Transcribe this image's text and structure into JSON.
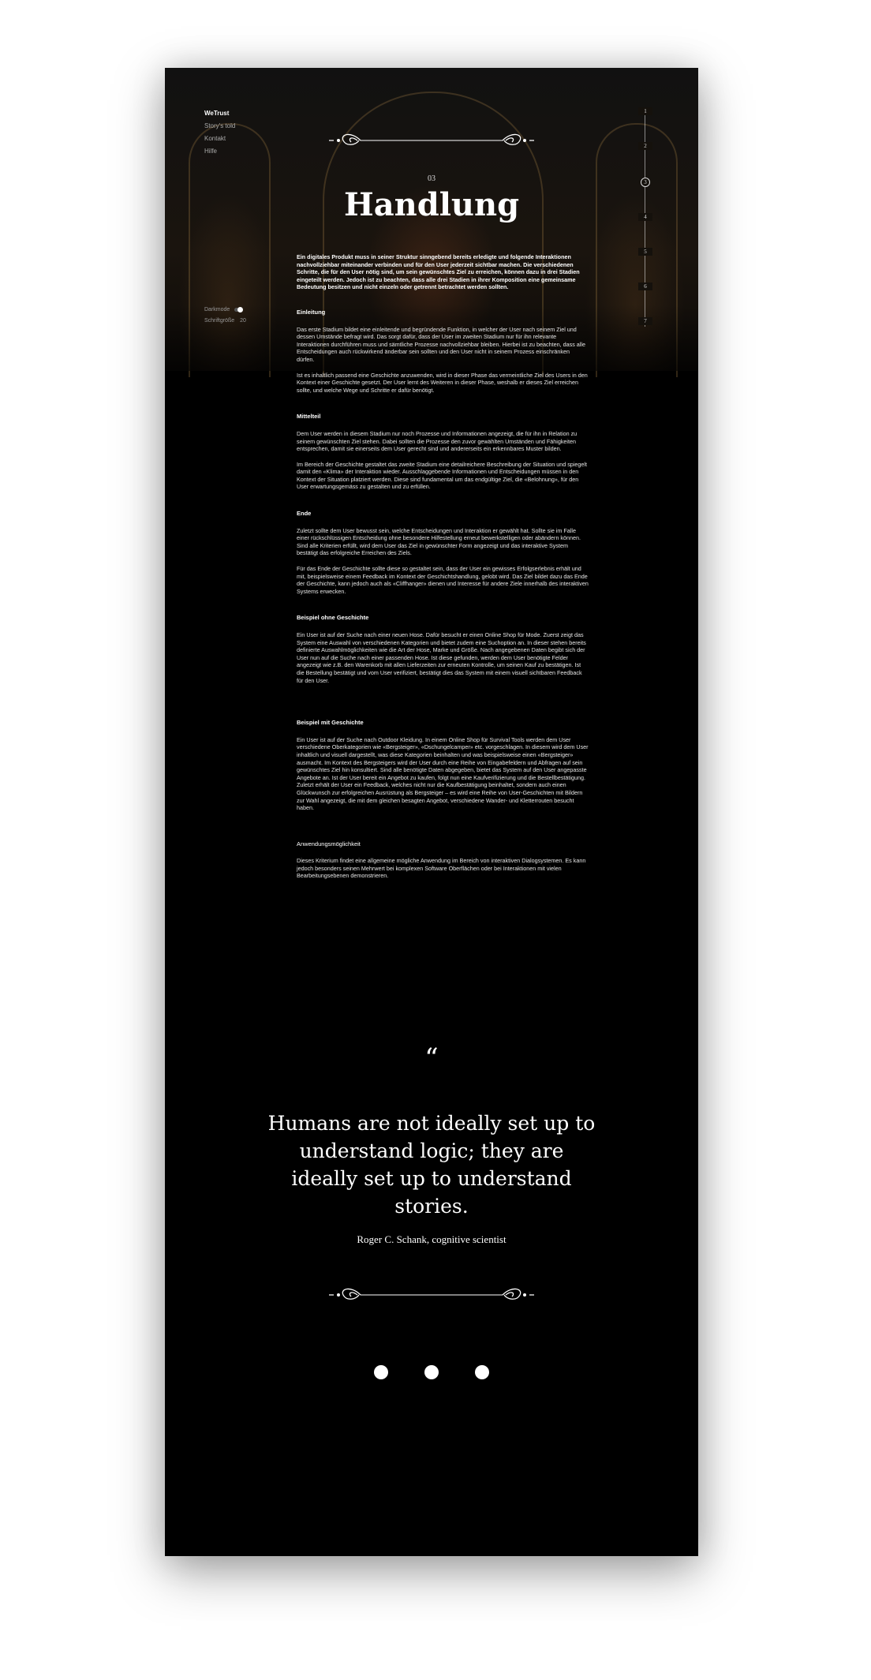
{
  "nav": {
    "brand": "WeTrust",
    "items": [
      "Story's told",
      "Kontakt",
      "Hilfe"
    ]
  },
  "settings": {
    "darkmode_label": "Darkmode",
    "font_size_label": "Schriftgröße",
    "font_size_value": "20",
    "darkmode_on": true
  },
  "steps": [
    "1",
    "2",
    "3",
    "4",
    "5",
    "6",
    "7"
  ],
  "active_step": "3",
  "section": {
    "number": "03",
    "title": "Handlung",
    "lead": "Ein digitales Produkt muss in seiner Struktur sinngebend bereits erledigte und folgende Interaktionen nachvollziehbar miteinander verbinden und für den User jederzeit sichtbar machen. Die verschiedenen Schritte, die für den User nötig sind, um sein gewünschtes Ziel zu erreichen, können dazu in drei Stadien eingeteilt werden. Jedoch ist zu beachten, dass alle drei Stadien in ihrer Komposition eine gemeinsame Bedeutung besitzen und nicht einzeln oder getrennt betrachtet werden sollten."
  },
  "blocks": [
    {
      "heading": "Einleitung",
      "paragraphs": [
        "Das erste Stadium bildet eine einleitende und begründende Funktion, in welcher der User nach seinem Ziel und dessen Umstände befragt wird. Das sorgt dafür, dass der User im zweiten Stadium nur für ihn relevante Interaktionen durchführen muss und sämtliche Prozesse nachvollziehbar bleiben. Hierbei ist zu beachten, dass alle Entscheidungen auch rückwirkend änderbar sein sollten und den User nicht in seinem Prozess einschränken dürfen.",
        "Ist es inhaltlich passend eine Geschichte anzuwenden, wird in dieser Phase das vermeintliche Ziel des Users in den Kontext einer Geschichte gesetzt. Der User lernt des Weiteren in dieser Phase, weshalb er dieses Ziel erreichen sollte, und welche Wege und Schritte er dafür benötigt."
      ]
    },
    {
      "heading": "Mittelteil",
      "paragraphs": [
        "Dem User werden in diesem Stadium nur noch Prozesse und Informationen angezeigt, die für ihn in Relation zu seinem gewünschten Ziel stehen. Dabei sollten die Prozesse den zuvor gewählten Umständen und Fähigkeiten entsprechen, damit sie einerseits dem User gerecht sind und andererseits ein erkennbares Muster bilden.",
        "Im Bereich der Geschichte gestaltet das zweite Stadium eine detailreichere Beschreibung der Situation und spiegelt damit den «Klima» der Interaktion wieder. Ausschlaggebende Informationen und Entscheidungen müssen in den Kontext der Situation platziert werden. Diese sind fundamental um das endgültige Ziel, die «Belohnung», für den User erwartungsgemäss zu gestalten und zu erfüllen."
      ]
    },
    {
      "heading": "Ende",
      "paragraphs": [
        "Zuletzt sollte dem User bewusst sein, welche Entscheidungen und Interaktion er gewählt hat. Sollte sie im Falle einer rückschlüssigen Entscheidung ohne besondere Hilfestellung erneut bewerkstelligen oder abändern können. Sind alle Kriterien erfüllt, wird dem User das Ziel in gewünschter Form angezeigt und das interaktive System bestätigt das erfolgreiche Erreichen des Ziels.",
        "Für das Ende der Geschichte sollte diese so gestaltet sein, dass der User ein gewisses Erfolgserlebnis erhält und mit, beispielsweise einem Feedback im Kontext der Geschichtshandlung, gelobt wird. Das Ziel bildet dazu das Ende der Geschichte, kann jedoch auch als «Cliffhanger» dienen und Interesse für andere Ziele innerhalb des interaktiven Systems erwecken."
      ]
    },
    {
      "heading": "Beispiel ohne Geschichte",
      "paragraphs": [
        "Ein User ist auf der Suche nach einer neuen Hose. Dafür besucht er einen Online Shop für Mode. Zuerst zeigt das System eine Auswahl von verschiedenen Kategorien und bietet zudem eine Suchoption an. In dieser stehen bereits definierte Auswahlmöglichkeiten wie die Art der Hose, Marke und Größe. Nach angegebenen Daten begibt sich der User nun auf die Suche nach einer passenden Hose. Ist diese gefunden, werden dem User benötigte Felder angezeigt wie z.B. den Warenkorb mit allen Lieferzeiten zur erneuten Kontrolle, um seinen Kauf zu bestätigen. Ist die Bestellung bestätigt und vom User verifiziert, bestätigt dies das System mit einem visuell sichtbaren Feedback für den User."
      ]
    },
    {
      "heading": "Beispiel mit Geschichte",
      "paragraphs": [
        "Ein User ist auf der Suche nach Outdoor Kleidung. In einem Online Shop für Survival Tools werden dem User verschiedene Oberkategorien wie «Bergsteiger», «Dschungelcamper» etc. vorgeschlagen. In diesem wird dem User inhaltlich und visuell dargestellt, was diese Kategorien beinhalten und was beispielsweise einen «Bergsteiger» ausmacht. Im Kontext des Bergsteigers wird der User durch eine Reihe von Eingabefeldern und Abfragen auf sein gewünschtes Ziel hin konsultiert. Sind alle benötigte Daten abgegeben, bietet das System auf den User angepasste Angebote an. Ist der User bereit ein Angebot zu kaufen, folgt nun eine Kaufverifizierung und die Bestellbestätigung. Zuletzt erhält der User ein Feedback, welches nicht nur die Kaufbestätigung beinhaltet, sondern auch einen Glückwunsch zur erfolgreichen Ausrüstung als Bergsteiger – es wird eine Reihe von User-Geschichten mit Bildern zur Wahl angezeigt, die mit dem gleichen besagten Angebot, verschiedene Wander- und Kletterrouten besucht haben."
      ]
    },
    {
      "heading": "Anwendungsmöglichkeit",
      "paragraphs": [
        "Dieses Kriterium findet eine allgemeine mögliche Anwendung im Bereich von interaktiven Dialogsystemen. Es kann jedoch besonders seinen Mehrwert bei komplexen Software Oberflächen oder bei Interaktionen mit vielen Bearbeitungsebenen demonstrieren."
      ]
    }
  ],
  "quote": {
    "mark": "“",
    "text": "Humans are not ideally set up to understand logic; they are ideally set up to understand stories.",
    "author": "Roger C. Schank, cognitive scientist"
  },
  "pagination_count": 3
}
